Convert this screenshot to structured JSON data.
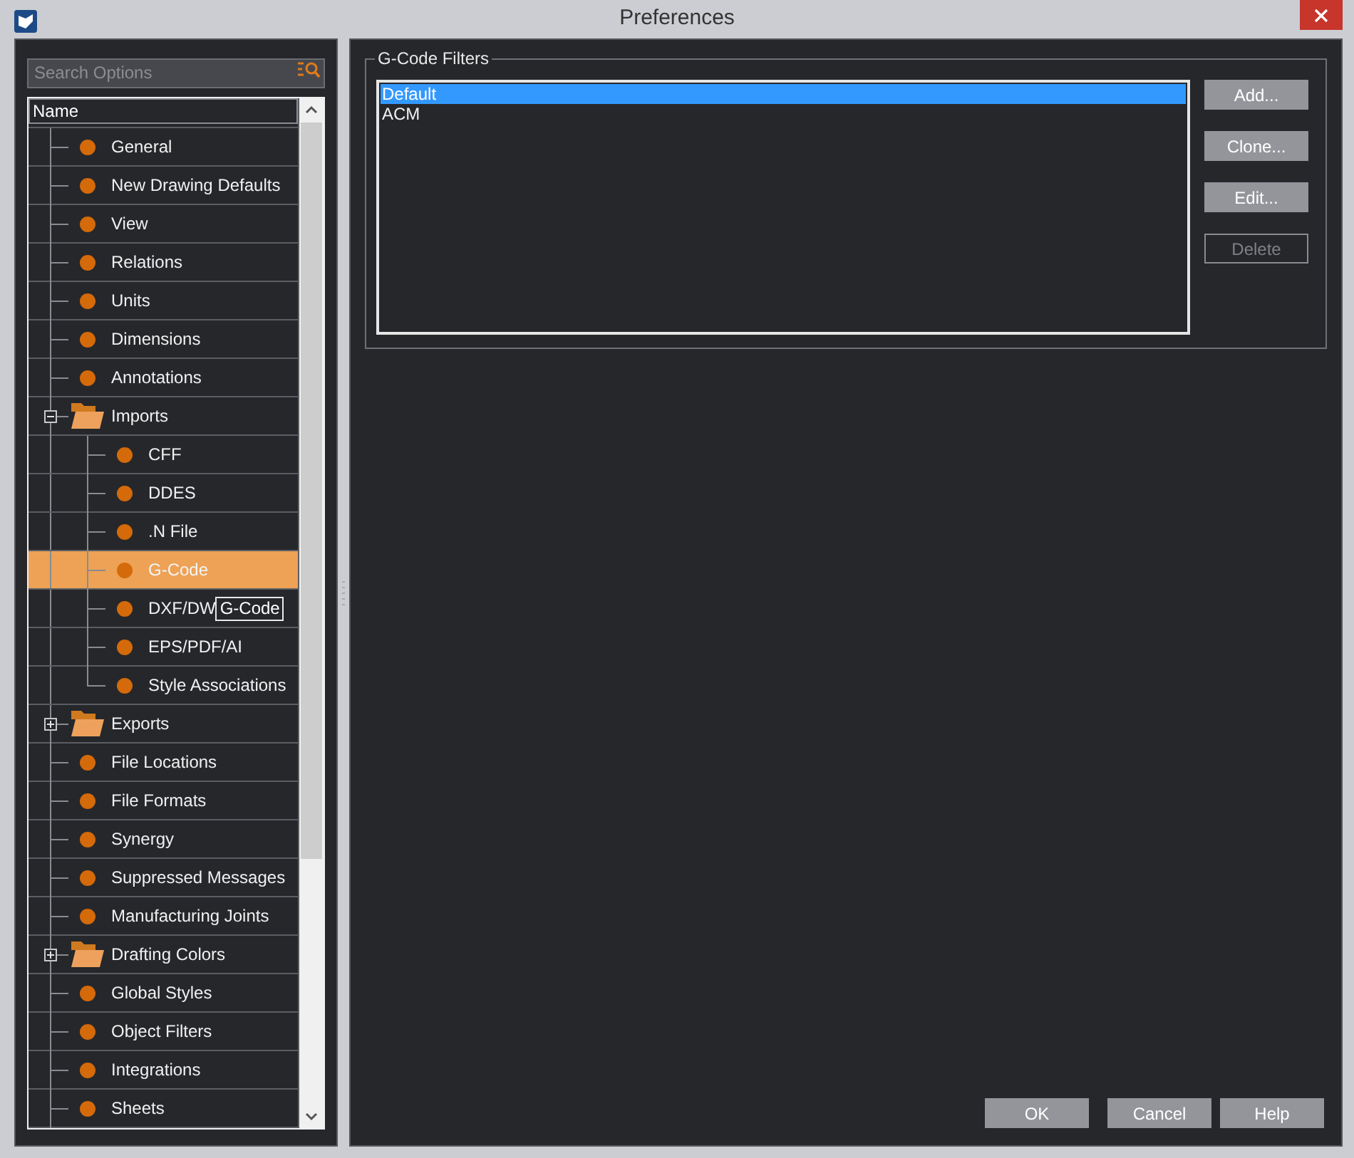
{
  "window": {
    "title": "Preferences"
  },
  "search": {
    "placeholder": "Search Options"
  },
  "tree": {
    "column_header": "Name",
    "items": [
      {
        "kind": "leaf",
        "label": "General",
        "selected": false
      },
      {
        "kind": "leaf",
        "label": "New Drawing Defaults",
        "selected": false
      },
      {
        "kind": "leaf",
        "label": "View",
        "selected": false
      },
      {
        "kind": "leaf",
        "label": "Relations",
        "selected": false
      },
      {
        "kind": "leaf",
        "label": "Units",
        "selected": false
      },
      {
        "kind": "leaf",
        "label": "Dimensions",
        "selected": false
      },
      {
        "kind": "leaf",
        "label": "Annotations",
        "selected": false
      },
      {
        "kind": "folder",
        "label": "Imports",
        "selected": false,
        "expanded": true,
        "children": [
          {
            "kind": "leaf",
            "label": "CFF",
            "selected": false
          },
          {
            "kind": "leaf",
            "label": "DDES",
            "selected": false
          },
          {
            "kind": "leaf",
            "label": ".N File",
            "selected": false
          },
          {
            "kind": "leaf",
            "label": "G-Code",
            "selected": true
          },
          {
            "kind": "leaf",
            "label": "DXF/DW",
            "selected": false,
            "tooltip": "G-Code"
          },
          {
            "kind": "leaf",
            "label": "EPS/PDF/AI",
            "selected": false
          },
          {
            "kind": "leaf",
            "label": "Style Associations",
            "selected": false
          }
        ]
      },
      {
        "kind": "folder",
        "label": "Exports",
        "selected": false,
        "expanded": false
      },
      {
        "kind": "leaf",
        "label": "File Locations",
        "selected": false
      },
      {
        "kind": "leaf",
        "label": "File Formats",
        "selected": false
      },
      {
        "kind": "leaf",
        "label": "Synergy",
        "selected": false
      },
      {
        "kind": "leaf",
        "label": "Suppressed Messages",
        "selected": false
      },
      {
        "kind": "leaf",
        "label": "Manufacturing Joints",
        "selected": false
      },
      {
        "kind": "folder",
        "label": "Drafting Colors",
        "selected": false,
        "expanded": false
      },
      {
        "kind": "leaf",
        "label": "Global Styles",
        "selected": false
      },
      {
        "kind": "leaf",
        "label": "Object Filters",
        "selected": false
      },
      {
        "kind": "leaf",
        "label": "Integrations",
        "selected": false
      },
      {
        "kind": "leaf",
        "label": "Sheets",
        "selected": false
      }
    ]
  },
  "filters": {
    "title": "G-Code Filters",
    "items": [
      {
        "label": "Default",
        "selected": true
      },
      {
        "label": "ACM",
        "selected": false
      }
    ],
    "buttons": [
      {
        "label": "Add...",
        "disabled": false
      },
      {
        "label": "Clone...",
        "disabled": false
      },
      {
        "label": "Edit...",
        "disabled": false
      },
      {
        "label": "Delete",
        "disabled": true
      }
    ]
  },
  "footer_buttons": [
    "OK",
    "Cancel",
    "Help"
  ]
}
